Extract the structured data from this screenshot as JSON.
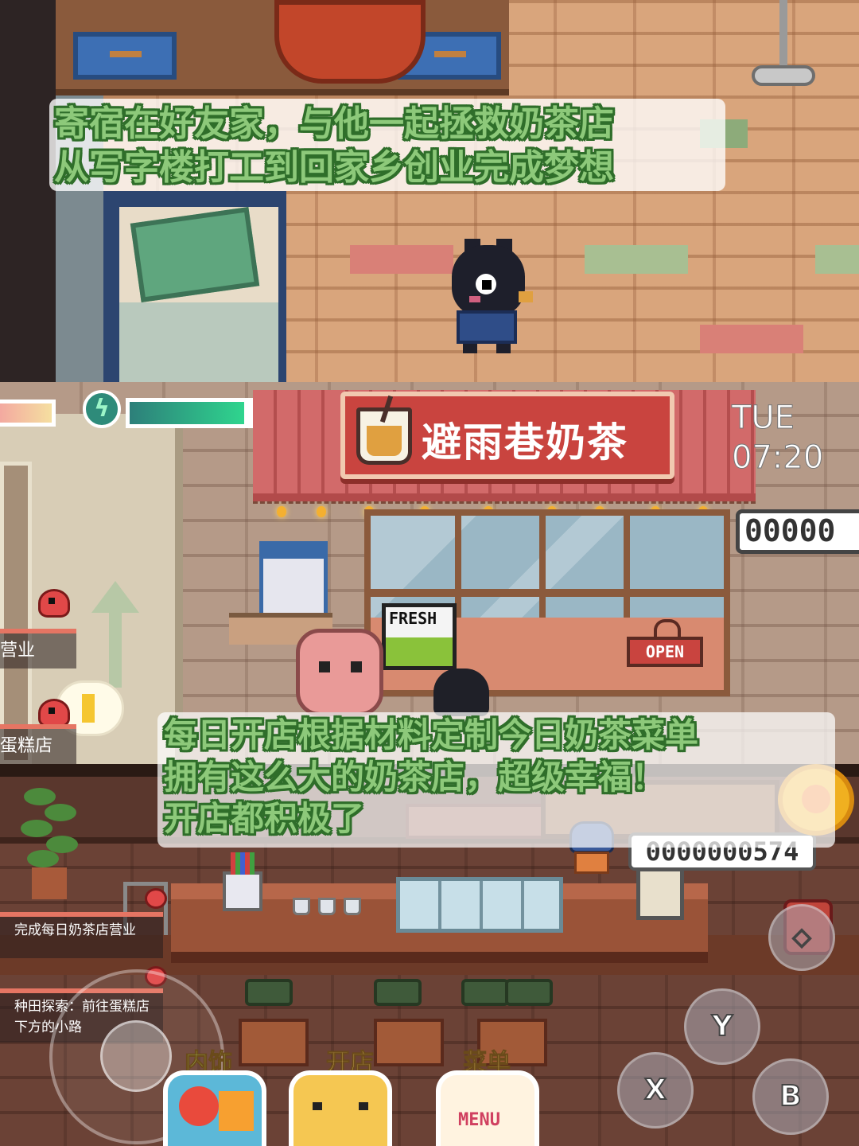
{
  "captions": {
    "top": {
      "line1": "寄宿在好友家，与他一起拯救奶茶店",
      "line2": "从写字楼打工到回家乡创业完成梦想"
    },
    "middle": {
      "line1": "每日开店根据材料定制今日奶茶菜单",
      "line2": "拥有这么大的奶茶店，超级幸福！",
      "line3": "开店都积极了"
    }
  },
  "shop_exterior": {
    "sign_text": "避雨巷奶茶",
    "fresh_poster": "FRESH",
    "open_sign": "OPEN",
    "hud": {
      "day": "TUE",
      "time": "07:20",
      "money_counter": "00000",
      "energy_icon": "lightning-icon",
      "energy_fraction": 0.8
    },
    "quests": [
      {
        "label": "营业"
      },
      {
        "label": "蛋糕店"
      }
    ]
  },
  "shop_interior": {
    "money_counter": "0000000574",
    "quests": [
      {
        "label": "完成每日奶茶店营业"
      },
      {
        "label": "种田探索：前往蛋糕店下方的小路"
      }
    ],
    "bottom_tabs": [
      {
        "label": "内饰",
        "icon": "sofa-icon"
      },
      {
        "label": "开店",
        "icon": "cat-face-icon"
      },
      {
        "label": "菜单",
        "icon": "menu-clipboard-icon",
        "icon_text": "MENU"
      }
    ],
    "buttons": {
      "y": "Y",
      "x": "X",
      "b": "B",
      "top": "◇"
    }
  },
  "colors": {
    "caption_fill": "#8dc97a",
    "caption_outline": "#2f6e2a",
    "sign_red": "#c9443f",
    "energy_green": "#2fd58e",
    "tab_label_yellow": "#f4d36a"
  }
}
